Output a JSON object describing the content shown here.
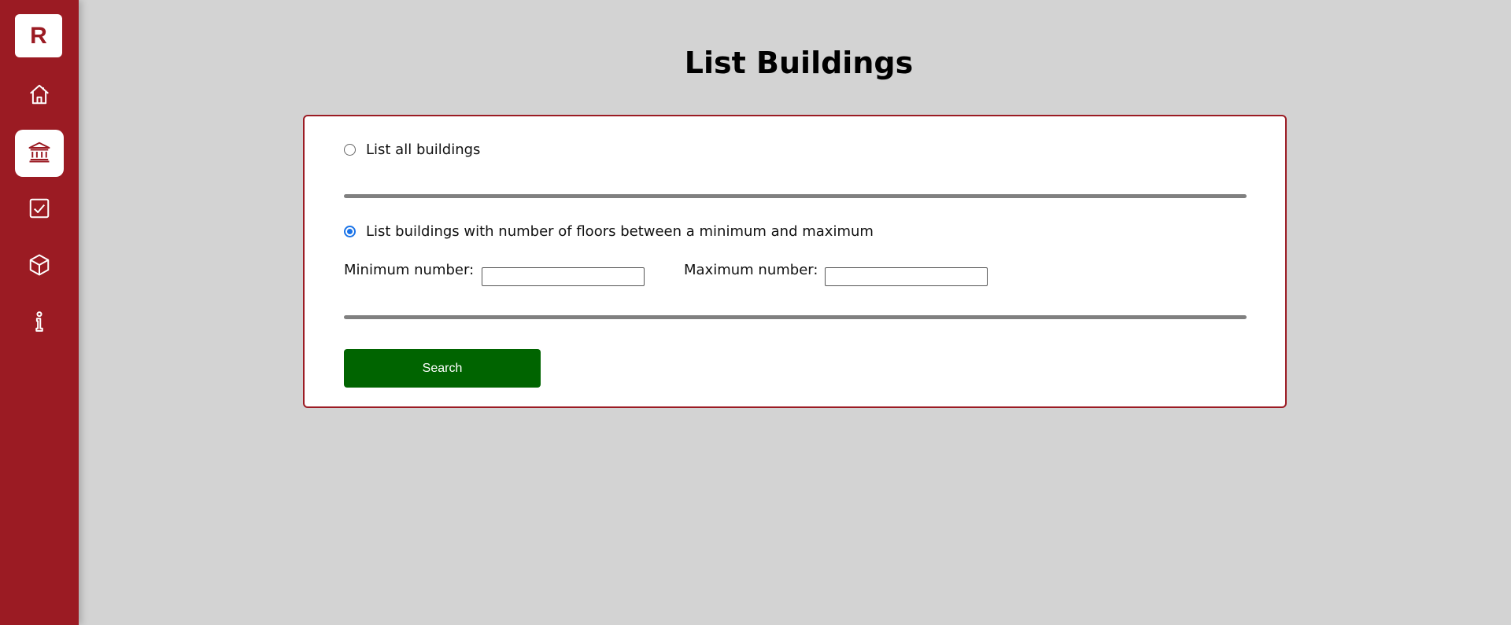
{
  "sidebar": {
    "logo_text": "R",
    "accent_color": "#9b1b23",
    "items": [
      {
        "icon": "home-icon",
        "active": false
      },
      {
        "icon": "building-icon",
        "active": true
      },
      {
        "icon": "checkbox-icon",
        "active": false
      },
      {
        "icon": "cube-icon",
        "active": false
      },
      {
        "icon": "info-icon",
        "active": false
      }
    ]
  },
  "main": {
    "title": "List Buildings",
    "options": {
      "all_label": "List all buildings",
      "all_selected": false,
      "range_label": "List buildings with number of floors between a minimum and maximum",
      "range_selected": true
    },
    "min_label": "Minimum number:",
    "min_value": "",
    "max_label": "Maximum number:",
    "max_value": "",
    "search_label": "Search",
    "search_color": "#006400"
  }
}
